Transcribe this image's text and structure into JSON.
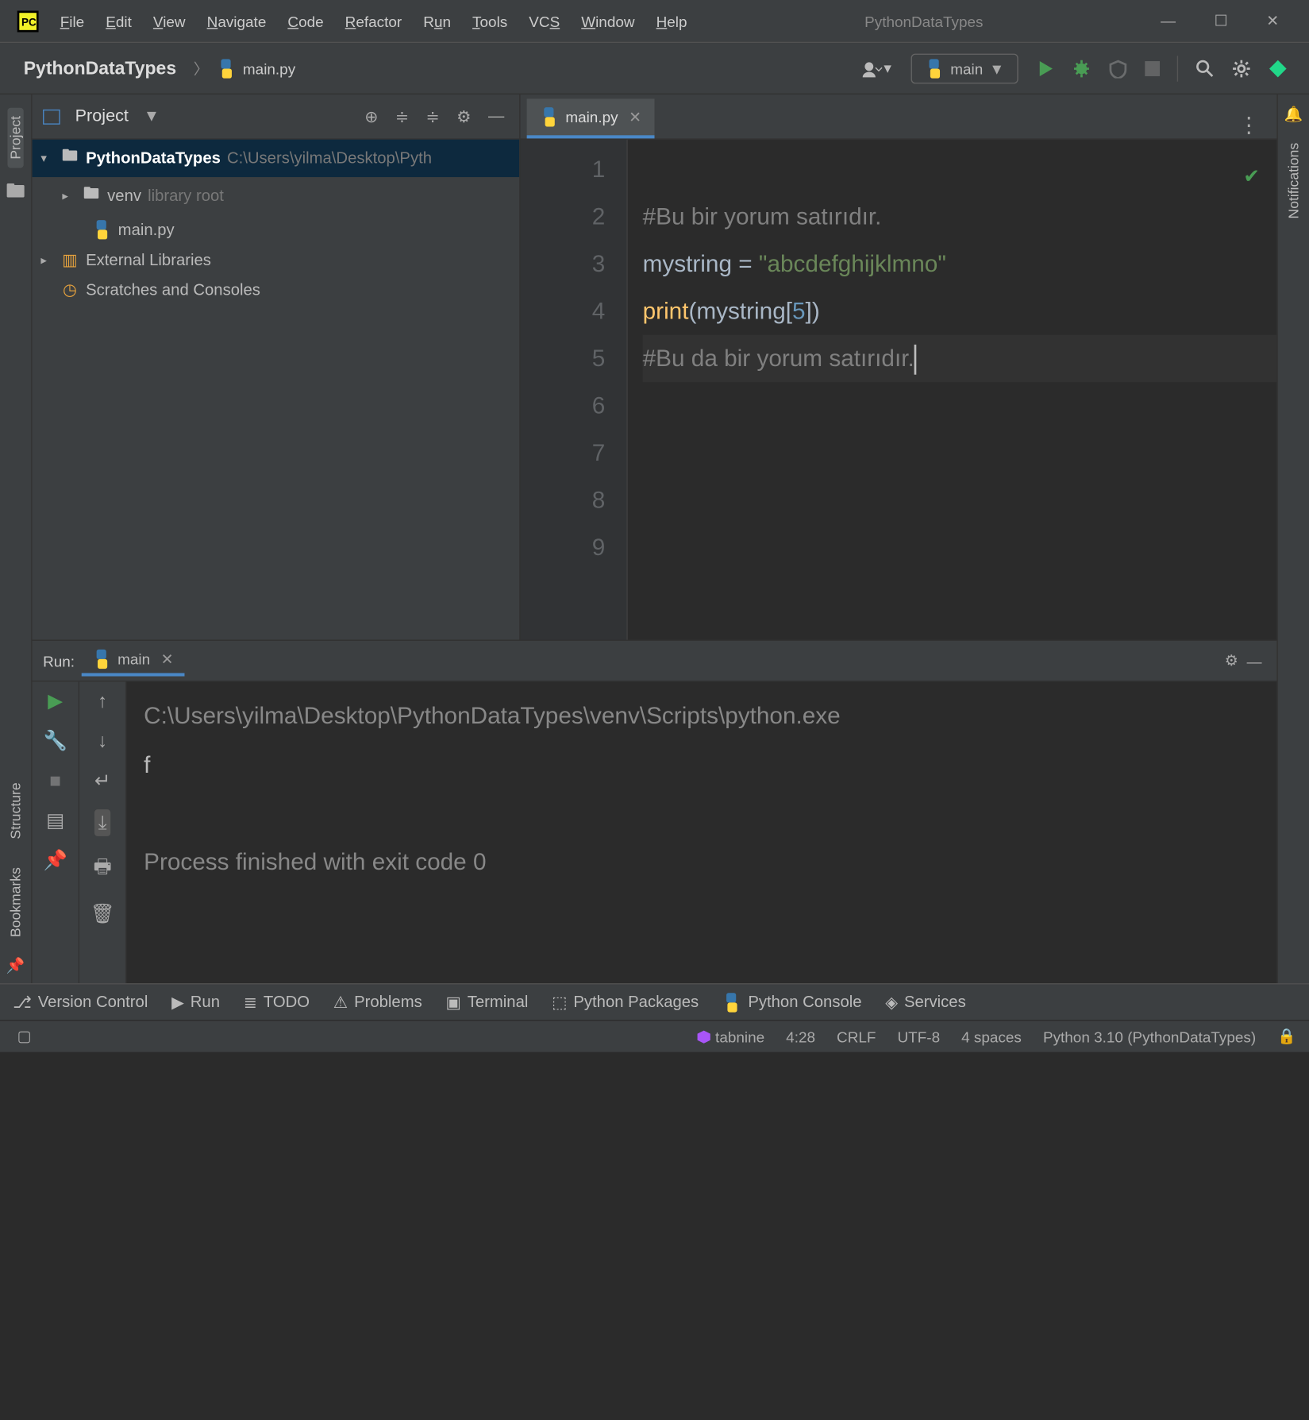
{
  "window": {
    "title": "PythonDataTypes"
  },
  "menubar": [
    "File",
    "Edit",
    "View",
    "Navigate",
    "Code",
    "Refactor",
    "Run",
    "Tools",
    "VCS",
    "Window",
    "Help"
  ],
  "breadcrumb": {
    "root": "PythonDataTypes",
    "file": "main.py"
  },
  "run_config": "main",
  "project_panel": {
    "title": "Project",
    "tree": {
      "root": {
        "name": "PythonDataTypes",
        "path": "C:\\Users\\yilma\\Desktop\\Pyth"
      },
      "venv": {
        "name": "venv",
        "hint": "library root"
      },
      "main": "main.py",
      "ext": "External Libraries",
      "scratch": "Scratches and Consoles"
    }
  },
  "editor": {
    "tab": "main.py",
    "gutter": [
      "1",
      "2",
      "3",
      "4",
      "5",
      "6",
      "7",
      "8",
      "9"
    ],
    "lines": {
      "l1": "#Bu bir yorum satırıdır.",
      "l2a": "mystring ",
      "l2b": "= ",
      "l2c": "\"abcdefghijklmno\"",
      "l3a": "print",
      "l3b": "(mystring[",
      "l3c": "5",
      "l3d": "])",
      "l4": "#Bu da bir yorum satırıdır."
    }
  },
  "run": {
    "label": "Run:",
    "tab": "main",
    "cmd": "C:\\Users\\yilma\\Desktop\\PythonDataTypes\\venv\\Scripts\\python.exe",
    "output": "f",
    "exit": "Process finished with exit code 0"
  },
  "left_rail": {
    "project": "Project",
    "structure": "Structure",
    "bookmarks": "Bookmarks"
  },
  "right_rail": {
    "notifications": "Notifications"
  },
  "bottom_tools": [
    "Version Control",
    "Run",
    "TODO",
    "Problems",
    "Terminal",
    "Python Packages",
    "Python Console",
    "Services"
  ],
  "status": {
    "tabnine": "tabnine",
    "pos": "4:28",
    "eol": "CRLF",
    "enc": "UTF-8",
    "indent": "4 spaces",
    "interp": "Python 3.10 (PythonDataTypes)"
  }
}
